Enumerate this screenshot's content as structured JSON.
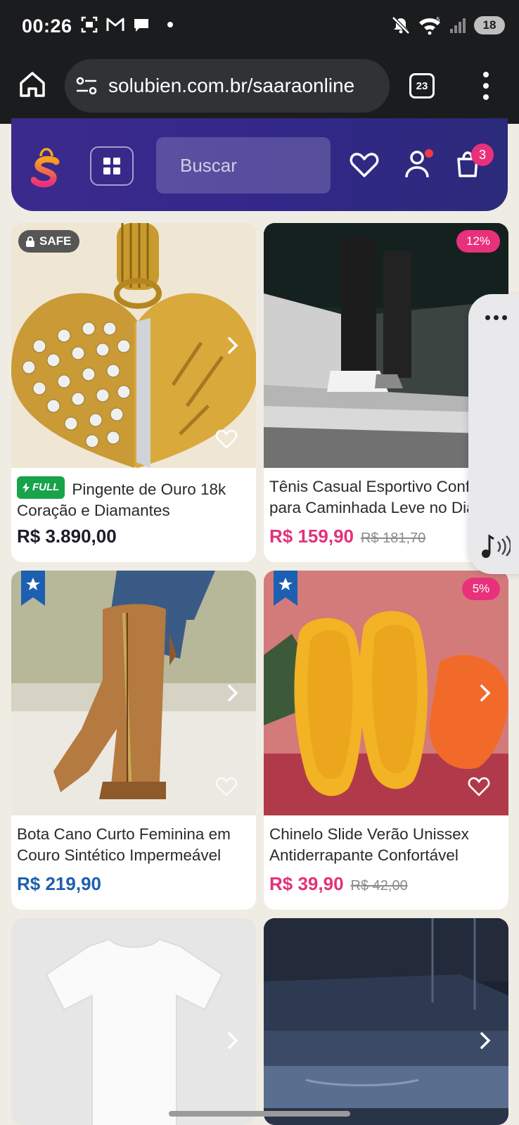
{
  "status_bar": {
    "time": "00:26",
    "battery": "18",
    "icons_left": [
      "screenshot-icon",
      "gmail-icon",
      "chat-icon"
    ],
    "icons_right": [
      "mute-icon",
      "wifi-icon",
      "signal-icon"
    ]
  },
  "browser": {
    "url": "solubien.com.br/saaraonline",
    "tab_count": "23"
  },
  "store_header": {
    "search_placeholder": "Buscar",
    "cart_count": "3",
    "brand_color": "#3b2a8c",
    "accent_color": "#e8317a"
  },
  "products": [
    {
      "badge_left": "SAFE",
      "badge_full": "FULL",
      "title_line1": "Pingente de Ouro 18k",
      "title_line2": "Coração e Diamantes",
      "price": "R$ 3.890,00",
      "price_color": "#1c1c2a"
    },
    {
      "discount": "12%",
      "title_line1": "Tênis Casual Esportivo Conf",
      "title_line2": "para Caminhada Leve no Dia",
      "price": "R$ 159,90",
      "old_price": "R$ 181,70",
      "price_color": "#e2317a"
    },
    {
      "ribbon": "star",
      "title_line1": "Bota Cano Curto Feminina em",
      "title_line2": "Couro Sintético Impermeável",
      "price": "R$ 219,90",
      "price_color": "#1d5fb0"
    },
    {
      "ribbon": "star",
      "discount": "5%",
      "title_line1": "Chinelo Slide Verão Unissex",
      "title_line2": "Antiderrapante Confortável",
      "price": "R$ 39,90",
      "old_price": "R$ 42,00",
      "price_color": "#e2317a"
    }
  ]
}
